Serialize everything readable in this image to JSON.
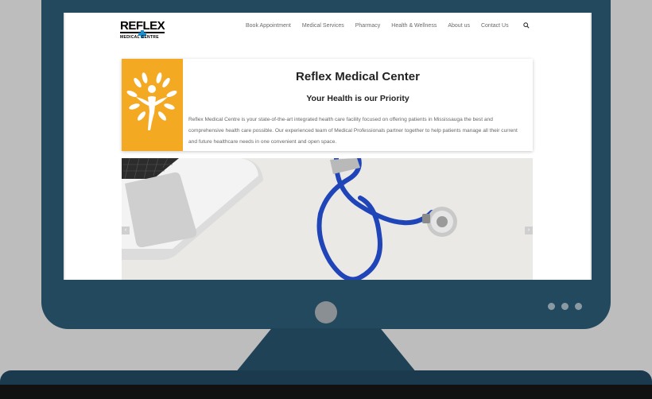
{
  "header": {
    "logo_title": "REFLEX",
    "logo_subtitle": "MEDICAL CENTRE",
    "nav": [
      {
        "label": "Book Appointment"
      },
      {
        "label": "Medical Services"
      },
      {
        "label": "Pharmacy"
      },
      {
        "label": "Health & Wellness"
      },
      {
        "label": "About us"
      },
      {
        "label": "Contact Us"
      }
    ],
    "search_icon": "search-icon"
  },
  "intro": {
    "title": "Reflex Medical Center",
    "subtitle": "Your Health is our Priority",
    "description": "Reflex Medical Centre is your state-of-the-art integrated health care facility focused on offering patients in Mississauga the best and comprehensive health care possible. Our experienced team of Medical Professionals partner together to help patients manage all their current and future healthcare needs in one convenient and open space.",
    "image_icon": "tree-person-icon"
  },
  "hero": {
    "image": "laptop-and-stethoscope-photo",
    "prev_arrow": "‹",
    "next_arrow": "›"
  },
  "colors": {
    "monitor": "#23495e",
    "accent_orange": "#f4a922",
    "stethoscope_blue": "#1f45b8",
    "logo_blue": "#1c8fd1"
  }
}
